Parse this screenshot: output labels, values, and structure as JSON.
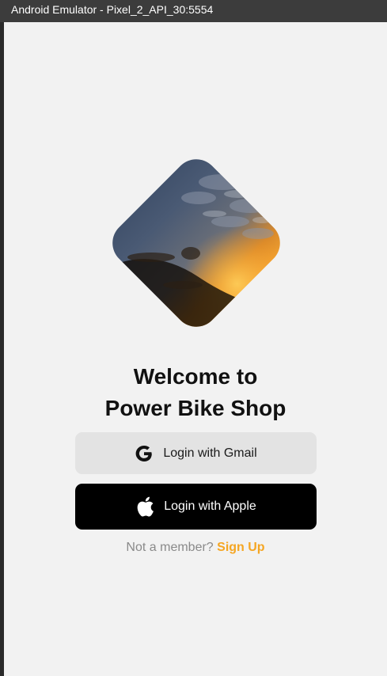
{
  "window": {
    "title": "Android Emulator - Pixel_2_API_30:5554"
  },
  "welcome": {
    "line1": "Welcome to",
    "line2": "Power Bike Shop"
  },
  "buttons": {
    "gmail": {
      "label": "Login with Gmail",
      "icon": "google-icon"
    },
    "apple": {
      "label": "Login with Apple",
      "icon": "apple-icon"
    }
  },
  "signup": {
    "prompt": "Not a member?",
    "link": "Sign Up"
  },
  "colors": {
    "background": "#f2f2f2",
    "accent": "#f5a623",
    "gmail_button": "#e3e3e3",
    "apple_button": "#000000"
  }
}
